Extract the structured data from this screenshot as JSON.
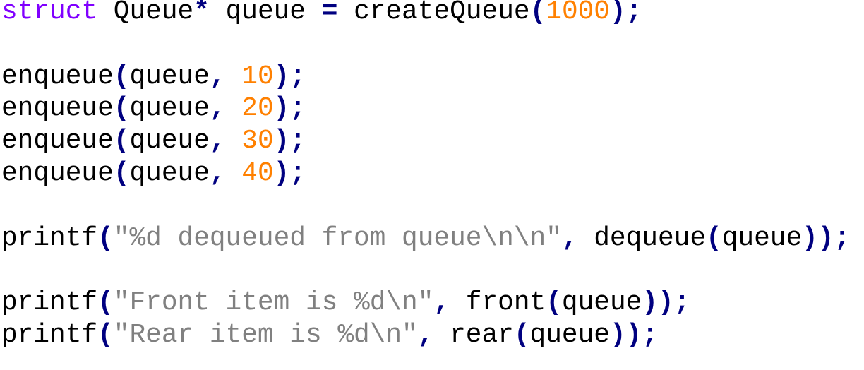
{
  "code": {
    "language": "C",
    "lines": [
      [
        {
          "t": "kw",
          "v": "struct"
        },
        {
          "t": "plain",
          "v": " "
        },
        {
          "t": "id",
          "v": "Queue"
        },
        {
          "t": "op",
          "v": "*"
        },
        {
          "t": "plain",
          "v": " "
        },
        {
          "t": "id",
          "v": "queue"
        },
        {
          "t": "plain",
          "v": " "
        },
        {
          "t": "op",
          "v": "="
        },
        {
          "t": "plain",
          "v": " "
        },
        {
          "t": "id",
          "v": "createQueue"
        },
        {
          "t": "punct",
          "v": "("
        },
        {
          "t": "num",
          "v": "1000"
        },
        {
          "t": "punct",
          "v": ")"
        },
        {
          "t": "punct",
          "v": ";"
        }
      ],
      [],
      [
        {
          "t": "id",
          "v": "enqueue"
        },
        {
          "t": "punct",
          "v": "("
        },
        {
          "t": "id",
          "v": "queue"
        },
        {
          "t": "punct",
          "v": ","
        },
        {
          "t": "plain",
          "v": " "
        },
        {
          "t": "num",
          "v": "10"
        },
        {
          "t": "punct",
          "v": ")"
        },
        {
          "t": "punct",
          "v": ";"
        }
      ],
      [
        {
          "t": "id",
          "v": "enqueue"
        },
        {
          "t": "punct",
          "v": "("
        },
        {
          "t": "id",
          "v": "queue"
        },
        {
          "t": "punct",
          "v": ","
        },
        {
          "t": "plain",
          "v": " "
        },
        {
          "t": "num",
          "v": "20"
        },
        {
          "t": "punct",
          "v": ")"
        },
        {
          "t": "punct",
          "v": ";"
        }
      ],
      [
        {
          "t": "id",
          "v": "enqueue"
        },
        {
          "t": "punct",
          "v": "("
        },
        {
          "t": "id",
          "v": "queue"
        },
        {
          "t": "punct",
          "v": ","
        },
        {
          "t": "plain",
          "v": " "
        },
        {
          "t": "num",
          "v": "30"
        },
        {
          "t": "punct",
          "v": ")"
        },
        {
          "t": "punct",
          "v": ";"
        }
      ],
      [
        {
          "t": "id",
          "v": "enqueue"
        },
        {
          "t": "punct",
          "v": "("
        },
        {
          "t": "id",
          "v": "queue"
        },
        {
          "t": "punct",
          "v": ","
        },
        {
          "t": "plain",
          "v": " "
        },
        {
          "t": "num",
          "v": "40"
        },
        {
          "t": "punct",
          "v": ")"
        },
        {
          "t": "punct",
          "v": ";"
        }
      ],
      [],
      [
        {
          "t": "id",
          "v": "printf"
        },
        {
          "t": "punct",
          "v": "("
        },
        {
          "t": "str",
          "v": "\"%d dequeued from queue\\n\\n\""
        },
        {
          "t": "punct",
          "v": ","
        },
        {
          "t": "plain",
          "v": " "
        },
        {
          "t": "id",
          "v": "dequeue"
        },
        {
          "t": "punct",
          "v": "("
        },
        {
          "t": "id",
          "v": "queue"
        },
        {
          "t": "punct",
          "v": ")"
        },
        {
          "t": "punct",
          "v": ")"
        },
        {
          "t": "punct",
          "v": ";"
        }
      ],
      [],
      [
        {
          "t": "id",
          "v": "printf"
        },
        {
          "t": "punct",
          "v": "("
        },
        {
          "t": "str",
          "v": "\"Front item is %d\\n\""
        },
        {
          "t": "punct",
          "v": ","
        },
        {
          "t": "plain",
          "v": " "
        },
        {
          "t": "id",
          "v": "front"
        },
        {
          "t": "punct",
          "v": "("
        },
        {
          "t": "id",
          "v": "queue"
        },
        {
          "t": "punct",
          "v": ")"
        },
        {
          "t": "punct",
          "v": ")"
        },
        {
          "t": "punct",
          "v": ";"
        }
      ],
      [
        {
          "t": "id",
          "v": "printf"
        },
        {
          "t": "punct",
          "v": "("
        },
        {
          "t": "str",
          "v": "\"Rear item is %d\\n\""
        },
        {
          "t": "punct",
          "v": ","
        },
        {
          "t": "plain",
          "v": " "
        },
        {
          "t": "id",
          "v": "rear"
        },
        {
          "t": "punct",
          "v": "("
        },
        {
          "t": "id",
          "v": "queue"
        },
        {
          "t": "punct",
          "v": ")"
        },
        {
          "t": "punct",
          "v": ")"
        },
        {
          "t": "punct",
          "v": ";"
        }
      ]
    ]
  },
  "colors": {
    "background": "#ffffff",
    "keyword": "#8000ff",
    "operator": "#000080",
    "number": "#ff8000",
    "string": "#808080",
    "identifier": "#000000"
  }
}
